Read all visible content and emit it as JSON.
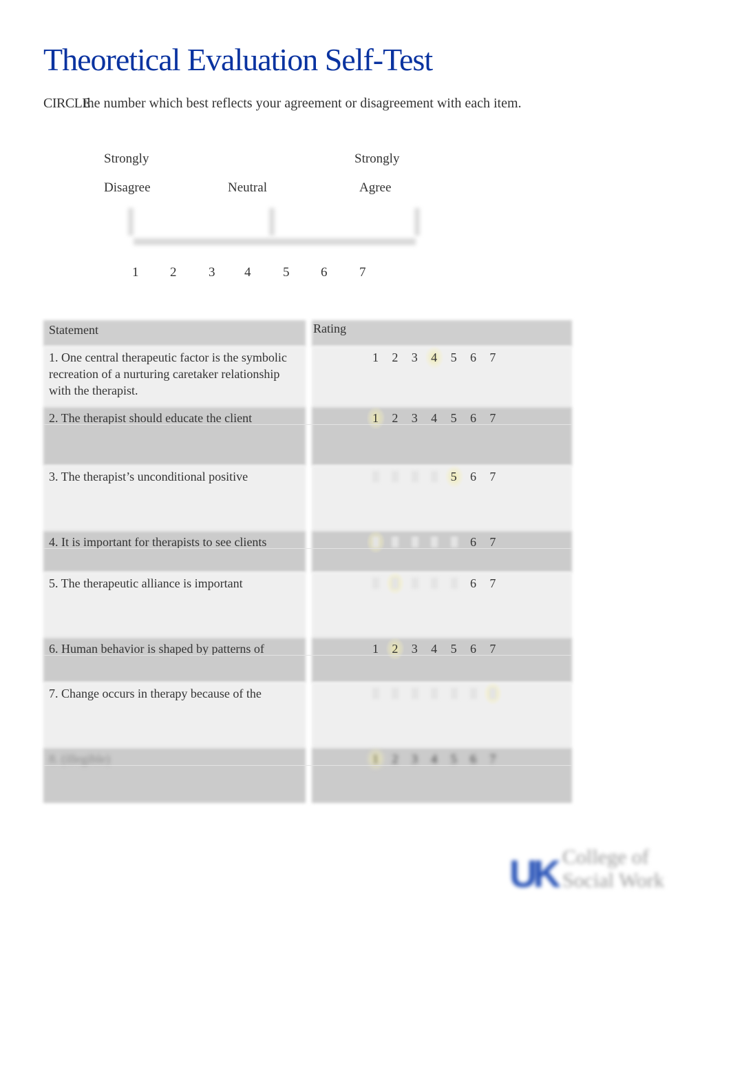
{
  "title": "Theoretical Evaluation Self-Test",
  "instruction": {
    "emphasis": "CIRCLE",
    "text": "the number which best reflects your agreement or disagreement with each item."
  },
  "scale": {
    "left_top": "Strongly",
    "left_bottom": "Disagree",
    "middle": "Neutral",
    "right_top": "Strongly",
    "right_bottom": "Agree",
    "numbers": [
      "1",
      "2",
      "3",
      "4",
      "5",
      "6",
      "7"
    ]
  },
  "table": {
    "headers": {
      "statement": "Statement",
      "rating": "Rating"
    },
    "rating_options": [
      "1",
      "2",
      "3",
      "4",
      "5",
      "6",
      "7"
    ],
    "rows": [
      {
        "statement": "1. One central therapeutic factor is the symbolic recreation of a nurturing caretaker relationship with the therapist.",
        "selected": 4
      },
      {
        "statement": "2. The therapist should educate the client",
        "selected": 1
      },
      {
        "statement": "3. The therapist’s unconditional positive",
        "selected": 5
      },
      {
        "statement": "4. It is important for therapists to see clients",
        "selected": 1
      },
      {
        "statement": "5. The therapeutic alliance is important",
        "selected": 2
      },
      {
        "statement": "6. Human behavior is shaped by patterns of",
        "selected": 2
      },
      {
        "statement": "7. Change occurs in therapy because of the",
        "selected": 7
      },
      {
        "statement": "8. (illegible)",
        "selected": 1
      }
    ]
  },
  "logo": {
    "mark": "UK",
    "line1": "College of",
    "line2": "Social Work",
    "color": "#2b55b8"
  },
  "colors": {
    "title": "#0a33a0",
    "text": "#333333",
    "header_bg": "#cfcfcf",
    "row_light": "#efefef",
    "row_dark": "#cbcbcb",
    "highlight": "#f0ebaa"
  }
}
